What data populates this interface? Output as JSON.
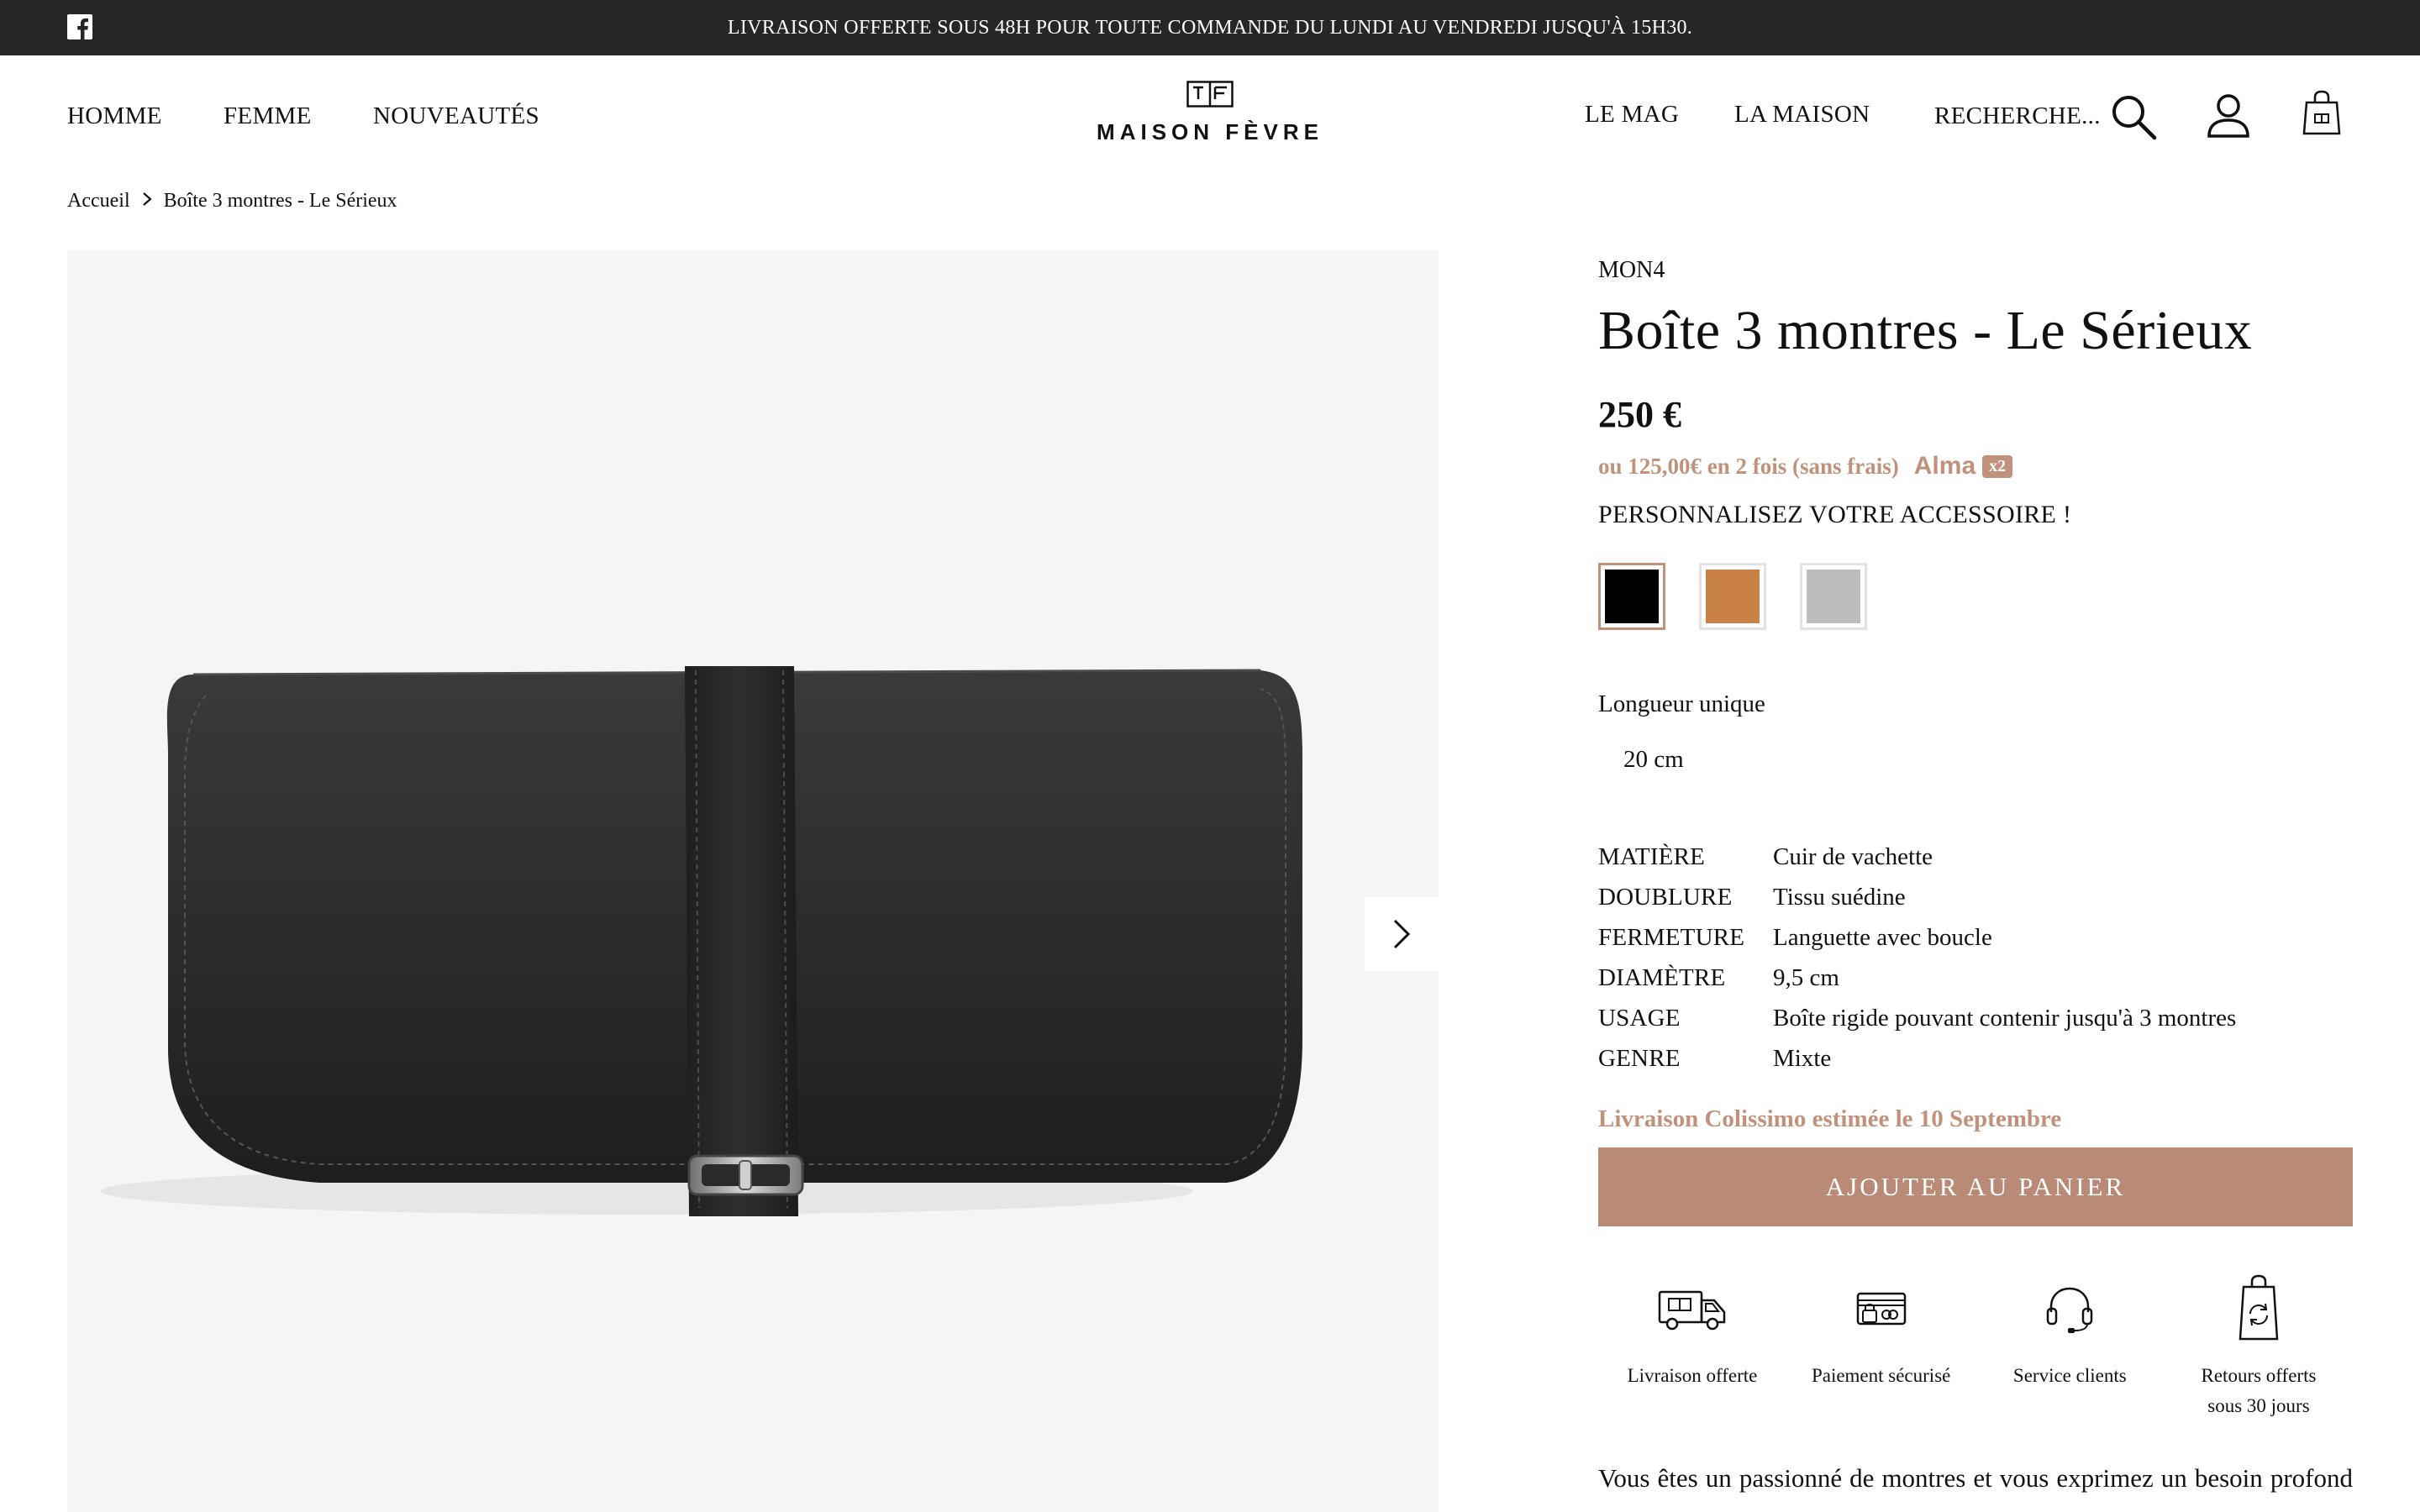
{
  "topbar": {
    "message": "LIVRAISON OFFERTE SOUS 48H POUR TOUTE COMMANDE DU LUNDI AU VENDREDI JUSQU'À 15H30."
  },
  "header": {
    "nav_left": [
      "HOMME",
      "FEMME",
      "NOUVEAUTÉS"
    ],
    "logo_text": "MAISON FÈVRE",
    "nav_right": [
      "LE MAG",
      "LA MAISON"
    ],
    "search_label": "RECHERCHE..."
  },
  "breadcrumb": {
    "home": "Accueil",
    "current": "Boîte 3 montres - Le Sérieux"
  },
  "product": {
    "reference": "MON4",
    "title": "Boîte 3 montres - Le Sérieux",
    "price": "250 €",
    "installment_text": "ou 125,00€ en 2 fois (sans frais)",
    "installment_brand": "Alma",
    "installment_badge": "x2",
    "customize_label": "PERSONNALISEZ VOTRE ACCESSOIRE !",
    "swatches": [
      {
        "color": "#000000",
        "selected": true
      },
      {
        "color": "#c98245",
        "selected": false
      },
      {
        "color": "#bdbdbd",
        "selected": false
      }
    ],
    "length_label": "Longueur unique",
    "length_value": "20 cm",
    "specs": [
      {
        "key": "MATIÈRE",
        "value": "Cuir de vachette"
      },
      {
        "key": "DOUBLURE",
        "value": "Tissu suédine"
      },
      {
        "key": "FERMETURE",
        "value": "Languette avec boucle"
      },
      {
        "key": "DIAMÈTRE",
        "value": "9,5 cm"
      },
      {
        "key": "USAGE",
        "value": "Boîte rigide pouvant contenir jusqu'à 3 montres"
      },
      {
        "key": "GENRE",
        "value": "Mixte"
      }
    ],
    "delivery_estimate": "Livraison Colissimo estimée le 10 Septembre",
    "add_to_cart": "AJOUTER AU PANIER",
    "description_start": "Vous êtes un passionné de montres et vous exprimez un besoin profond"
  },
  "features": [
    {
      "icon": "truck-icon",
      "label": "Livraison offerte"
    },
    {
      "icon": "card-icon",
      "label": "Paiement sécurisé"
    },
    {
      "icon": "headset-icon",
      "label": "Service clients"
    },
    {
      "icon": "return-bag-icon",
      "label_line1": "Retours offerts",
      "label_line2": "sous 30 jours"
    }
  ],
  "colors": {
    "accent": "#b98a75",
    "accent_text": "#c0927c",
    "topbar_bg": "#262626",
    "gallery_bg": "#f5f5f5"
  }
}
